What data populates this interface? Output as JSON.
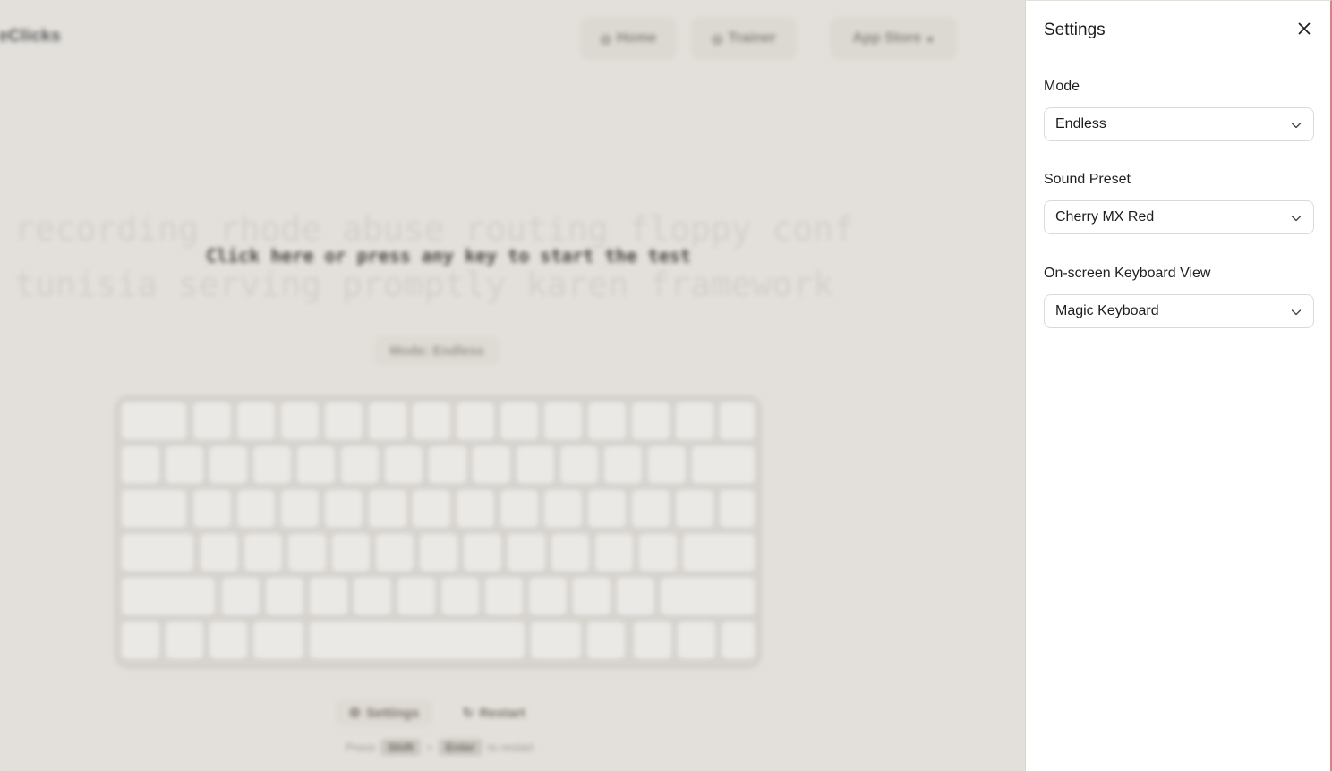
{
  "background_app": {
    "logo_text": "eClicks",
    "nav": [
      {
        "label": "Home",
        "icon": "home-icon"
      },
      {
        "label": "Trainer",
        "icon": "trainer-icon"
      },
      {
        "label": "App Store",
        "icon": "apple-icon"
      }
    ],
    "ghost_text_line1": "recording rhode abuse routing floppy conf",
    "ghost_text_line2": "tunisia serving promptly karen framework",
    "prompt_text": "Click here or press any key to start the test",
    "mode_pill": "Mode: Endless",
    "settings_button": "Settings",
    "restart_button": "Restart",
    "hint": {
      "prefix": "Press",
      "key1": "Shift",
      "joiner": "+",
      "key2": "Enter",
      "suffix": "to restart"
    }
  },
  "settings_panel": {
    "title": "Settings",
    "close_icon": "close-icon",
    "fields": [
      {
        "label": "Mode",
        "value": "Endless"
      },
      {
        "label": "Sound Preset",
        "value": "Cherry MX Red"
      },
      {
        "label": "On-screen Keyboard View",
        "value": "Magic Keyboard"
      }
    ]
  },
  "colors": {
    "page_background": "#e3e0db",
    "panel_background": "#ffffff",
    "panel_edge_accent": "#d4828b"
  }
}
